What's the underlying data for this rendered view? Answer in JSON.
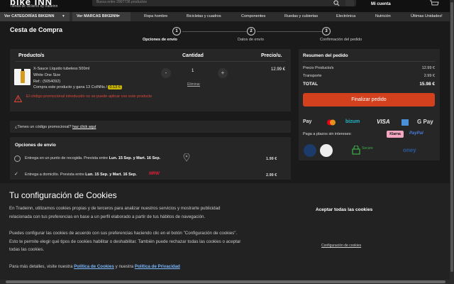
{
  "header": {
    "logo": "bike INN",
    "logo_sub": "Tienda de ciclismo by tradeinn",
    "search_placeholder": "Busca entre 2907736 productos",
    "account": "Mi cuenta"
  },
  "nav": {
    "categories": "Ver CATEGORÍAS BIKEINN",
    "brands": "Ver MARCAS BIKEINN",
    "items": [
      "Ropa hombre",
      "Bicicletas y cuadros",
      "Componentes",
      "Ruedas y cubiertas",
      "Electrónica",
      "Nutrición",
      "Últimas Unidades!"
    ]
  },
  "page_title": "Cesta de Compra",
  "steps": [
    {
      "num": "1",
      "label": "Opciones de envío"
    },
    {
      "num": "2",
      "label": "Datos de envío"
    },
    {
      "num": "3",
      "label": "Confirmación del pedido"
    }
  ],
  "cart": {
    "col_product": "Producto/s",
    "col_qty": "Cantidad",
    "col_price": "Precio/u.",
    "product": {
      "name": "X-Sauce Líquido tubeless 500ml",
      "variant": "White One Size",
      "ref": "Ref.: (5054092)",
      "earn_prefix": "Compra este producto y gana 13 CoINNs /",
      "earn_value": "0.13 €",
      "qty": "1",
      "minus": "-",
      "plus": "+",
      "remove": "Eliminar",
      "price": "12.99 €"
    },
    "error": "El código promocional introducido no se puede aplicar con este producto"
  },
  "promo": {
    "question": "¿Tienes un código promocional?",
    "link": "haz click aquí"
  },
  "shipping": {
    "title": "Opciones de envío",
    "option1_prefix": "Entrega en un punto de recogida. Prevista entre",
    "option1_dates": "Lun. 15 Sep. y Mart. 16 Sep.",
    "option1_price": "1.99 €",
    "option2_prefix": "Entrega a domicilio. Prevista entre",
    "option2_dates": "Lun. 15 Sep. y Mart. 16 Sep.",
    "option2_price": "2.99 €",
    "carrier": "MRW"
  },
  "summary": {
    "title": "Resumen del pedido",
    "subtotal_label": "Precio Producto/s",
    "subtotal": "12.99 €",
    "shipping_label": "Transporte",
    "shipping": "2.99 €",
    "total_label": "TOTAL",
    "total": "15.98 €",
    "pay_button": "Finalizar pedido",
    "pay_methods": [
      "Pay",
      "bizum",
      "VISA",
      "G Pay"
    ],
    "installments": "Paga a plazos sin intereses:",
    "klarna": "Klarna",
    "paypal": "PayPal",
    "trust": [
      "Secure",
      "oney"
    ]
  },
  "cookie": {
    "title": "Tu configuración de Cookies",
    "p1": "En Tradeinn, utilizamos cookies propias y de terceros para analizar nuestros servicios y mostrarte publicidad relacionada con tus preferencias en base a un perfil elaborado a partir de tus hábitos de navegación.",
    "p2": "Puedes configurar las cookies de acuerdo con sus preferencias haciendo clic en el botón \"Configuración de cookies\". Esto te permite elegir qué tipos de cookies habilitar o deshabilitar. También puede rechazar todas las cookies o aceptar todas las cookies.",
    "p3_prefix": "Para más detalles, visite nuestra",
    "p3_link1": "Política de Cookies",
    "p3_mid": "y nuestra",
    "p3_link2": "Política de Privacidad",
    "accept": "Aceptar todas las cookies",
    "config": "Configuración de cookies"
  },
  "colors": {
    "accent": "#d2401e",
    "error": "#e0473a",
    "background": "#1a1a1a"
  }
}
